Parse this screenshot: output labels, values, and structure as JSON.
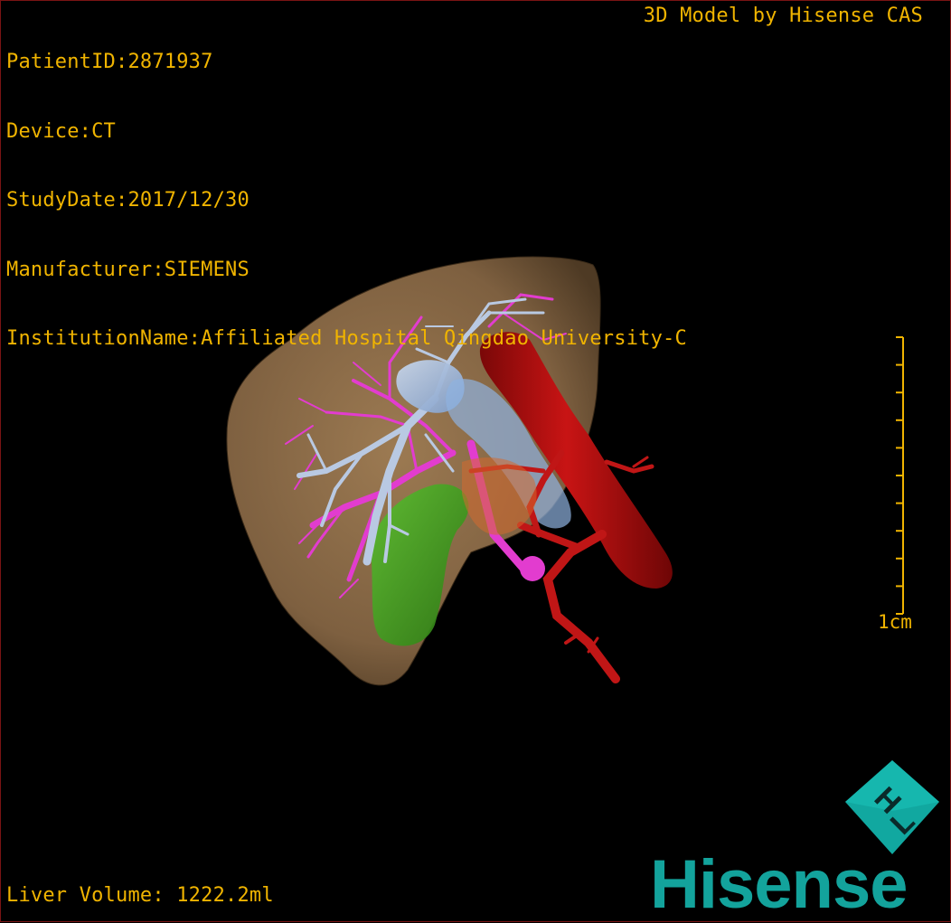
{
  "patient_info": {
    "patient_id": "PatientID:2871937",
    "device": "Device:CT",
    "study_date": "StudyDate:2017/12/30",
    "manufacturer": "Manufacturer:SIEMENS",
    "institution": "InstitutionName:Affiliated Hospital Qingdao University-C"
  },
  "credit": "3D Model by Hisense CAS",
  "liver_volume": "Liver Volume: 1222.2ml",
  "scale_bar": {
    "label": "1cm",
    "ticks": 10
  },
  "logo": {
    "word": "Hisense",
    "cube_letters": [
      "H",
      "L"
    ]
  },
  "colors": {
    "overlay_text": "#f0b400",
    "liver": "#8b6a45",
    "portal_vein": "#b8c8e0",
    "hepatic_vein": "#e040c8",
    "artery_ivc": "#b80f0f",
    "gallbladder": "#3aa020",
    "brand": "#13a39c"
  }
}
